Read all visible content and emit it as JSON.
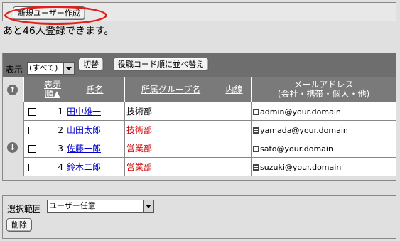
{
  "header": {
    "new_user_label": "新規ユーザー作成",
    "remaining_text": "あと46人登録できます。"
  },
  "toolbar": {
    "display_label": "表示",
    "filter_value": "(すべて)",
    "switch_label": "切替",
    "sort_label": "役職コード順に並べ替え"
  },
  "table": {
    "headers": {
      "order": "表示順▲",
      "name": "氏名",
      "group": "所属グループ名",
      "extension": "内線",
      "email_line1": "メールアドレス",
      "email_line2": "(会社・携帯・個人・他)"
    },
    "rows": [
      {
        "order": "1",
        "name": "田中雄一",
        "group": "技術部",
        "group_color": "#000000",
        "email": "admin@your.domain",
        "extension": ""
      },
      {
        "order": "2",
        "name": "山田太郎",
        "group": "技術部",
        "group_color": "#cc0000",
        "email": "yamada@your.domain",
        "extension": ""
      },
      {
        "order": "3",
        "name": "佐藤一郎",
        "group": "営業部",
        "group_color": "#cc0000",
        "email": "sato@your.domain",
        "extension": ""
      },
      {
        "order": "4",
        "name": "鈴木二郎",
        "group": "営業部",
        "group_color": "#cc0000",
        "email": "suzuki@your.domain",
        "extension": ""
      }
    ]
  },
  "bottom": {
    "range_label": "選択範囲",
    "range_value": "ユーザー任意",
    "delete_label": "削除"
  },
  "colors": {
    "highlight": "#e0201c",
    "toolbar_bg": "#6e6e6e",
    "link": "#0000cc"
  }
}
